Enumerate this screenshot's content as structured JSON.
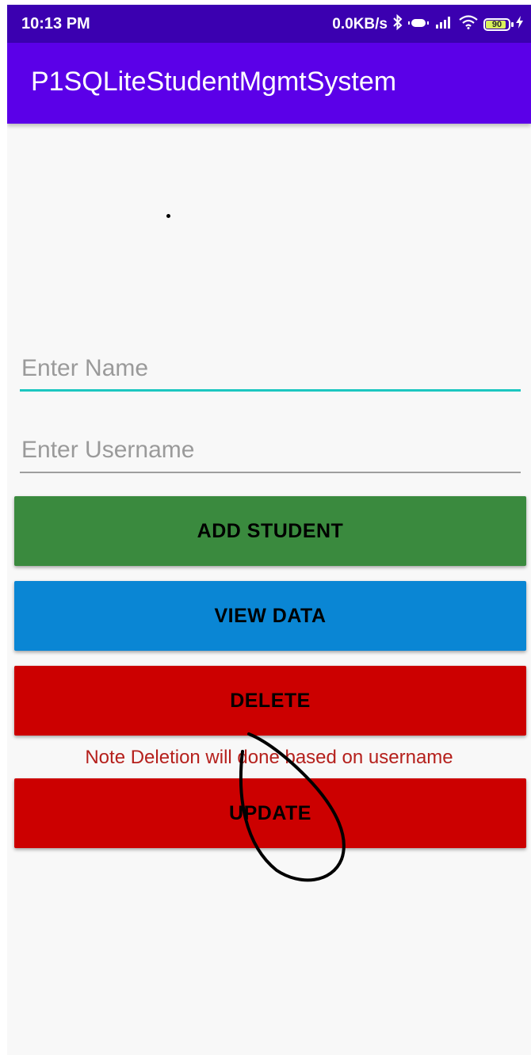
{
  "status_bar": {
    "time": "10:13 PM",
    "network_speed": "0.0KB/s",
    "battery_level": "90",
    "battery_fraction": 0.9,
    "icons": [
      "bluetooth-icon",
      "vibrate-icon",
      "signal-icon",
      "wifi-icon",
      "battery-icon",
      "charging-icon"
    ]
  },
  "app_bar": {
    "title": "P1SQLiteStudentMgmtSystem"
  },
  "form": {
    "name_placeholder": "Enter Name",
    "name_value": "",
    "username_placeholder": "Enter Username",
    "username_value": ""
  },
  "buttons": {
    "add": "ADD STUDENT",
    "view": "VIEW DATA",
    "delete": "DELETE",
    "update": "UPDATE"
  },
  "note": "Note Deletion will done based on username",
  "colors": {
    "status_bar": "#3b00b0",
    "app_bar": "#5b00e8",
    "add_button": "#3a8a3e",
    "view_button": "#0a86d4",
    "delete_button": "#cc0000",
    "update_button": "#cc0000",
    "note_text": "#b5201c",
    "name_underline": "#1cc7c0"
  }
}
